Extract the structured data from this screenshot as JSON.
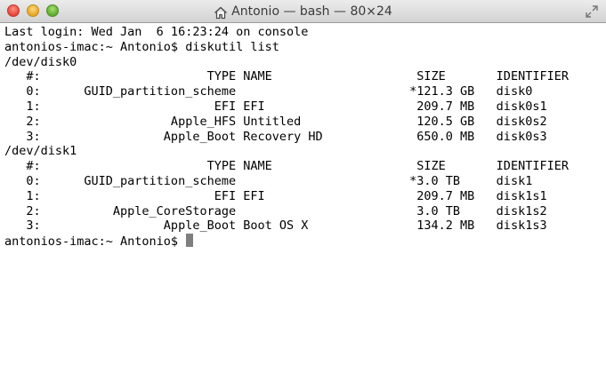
{
  "window": {
    "title": "Antonio — bash — 80×24",
    "title_icon": "home-icon"
  },
  "terminal": {
    "lines": [
      "Last login: Wed Jan  6 16:23:24 on console",
      "antonios-imac:~ Antonio$ diskutil list",
      "/dev/disk0",
      "   #:                       TYPE NAME                    SIZE       IDENTIFIER",
      "   0:      GUID_partition_scheme                        *121.3 GB   disk0",
      "   1:                        EFI EFI                     209.7 MB   disk0s1",
      "   2:                  Apple_HFS Untitled                120.5 GB   disk0s2",
      "   3:                 Apple_Boot Recovery HD             650.0 MB   disk0s3",
      "/dev/disk1",
      "   #:                       TYPE NAME                    SIZE       IDENTIFIER",
      "   0:      GUID_partition_scheme                        *3.0 TB     disk1",
      "   1:                        EFI EFI                     209.7 MB   disk1s1",
      "   2:          Apple_CoreStorage                         3.0 TB     disk1s2",
      "   3:                 Apple_Boot Boot OS X               134.2 MB   disk1s3"
    ],
    "prompt": "antonios-imac:~ Antonio$ "
  }
}
